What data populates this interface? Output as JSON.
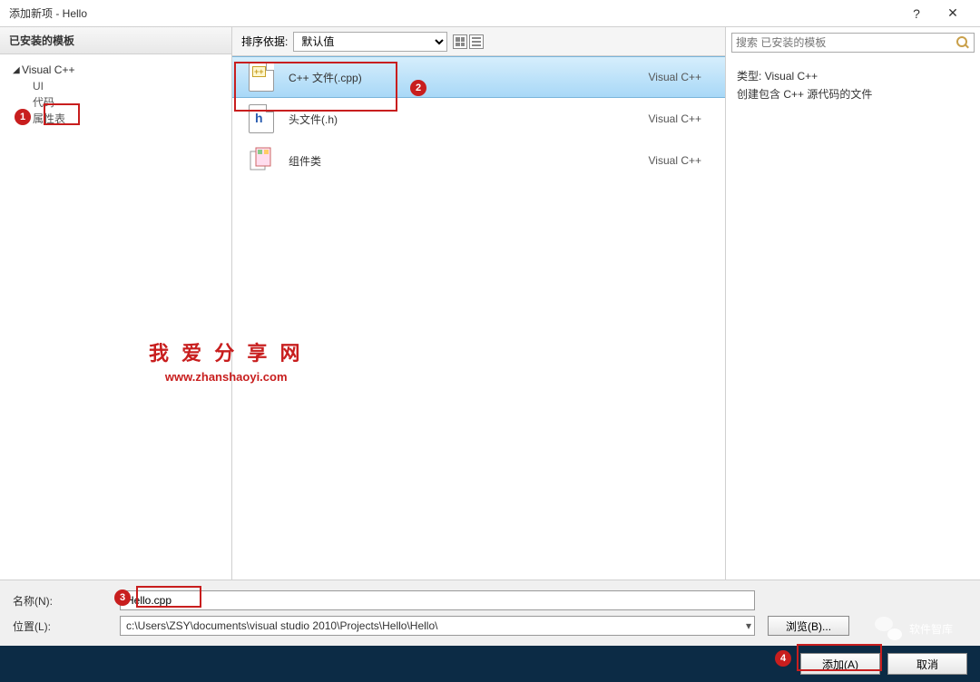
{
  "window": {
    "title": "添加新项 - Hello",
    "help": "?",
    "close": "✕"
  },
  "sidebar": {
    "header": "已安装的模板",
    "root": "Visual C++",
    "children": [
      "UI",
      "代码",
      "属性表"
    ]
  },
  "sort": {
    "label": "排序依据:",
    "value": "默认值"
  },
  "templates": [
    {
      "label": "C++ 文件(.cpp)",
      "lang": "Visual C++",
      "icon": "cpp",
      "selected": true
    },
    {
      "label": "头文件(.h)",
      "lang": "Visual C++",
      "icon": "h",
      "selected": false
    },
    {
      "label": "组件类",
      "lang": "Visual C++",
      "icon": "comp",
      "selected": false
    }
  ],
  "search": {
    "placeholder": "搜索 已安装的模板"
  },
  "desc": {
    "type_label": "类型:",
    "type_value": "Visual C++",
    "text": "创建包含 C++ 源代码的文件"
  },
  "form": {
    "name_label": "名称(N):",
    "name_value": "Hello.cpp",
    "loc_label": "位置(L):",
    "loc_value": "c:\\Users\\ZSY\\documents\\visual studio 2010\\Projects\\Hello\\Hello\\",
    "browse": "浏览(B)..."
  },
  "footer": {
    "add": "添加(A)",
    "cancel": "取消"
  },
  "callouts": [
    "1",
    "2",
    "3",
    "4"
  ],
  "watermark": {
    "cn": "我 爱 分 享 网",
    "url": "www.zhanshaoyi.com"
  },
  "wechat": "软件智库"
}
